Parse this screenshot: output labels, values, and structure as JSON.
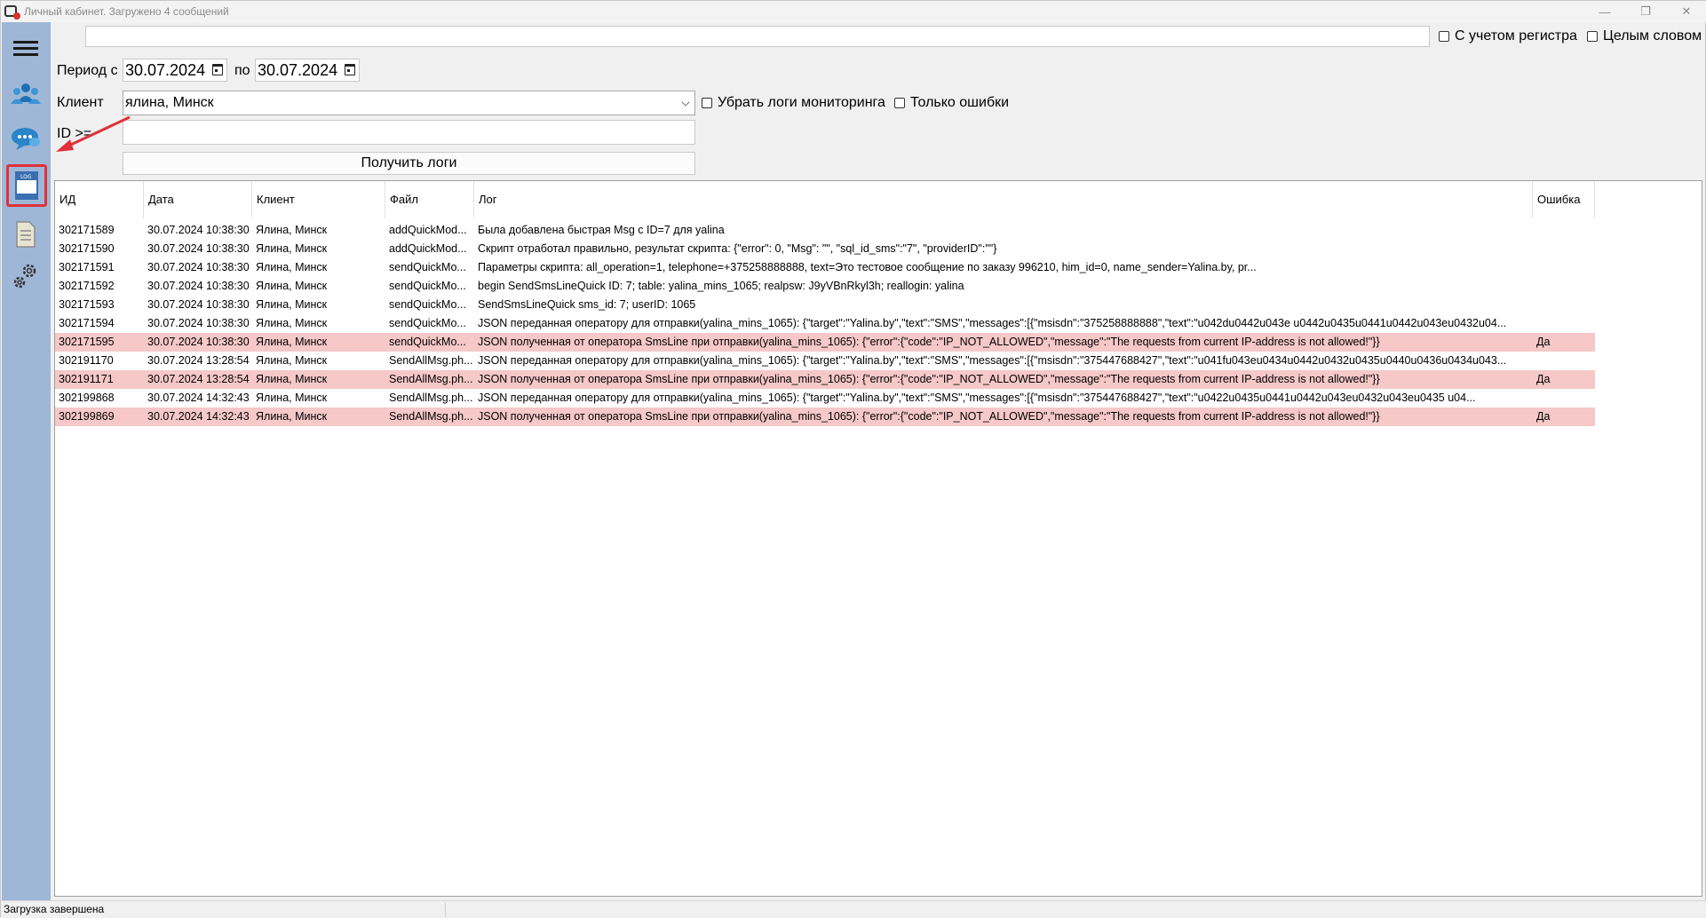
{
  "window": {
    "title": "Личный кабинет. Загружено 4 сообщений",
    "controls": [
      "—",
      "❐",
      "✕"
    ]
  },
  "sidebar": {
    "items": [
      {
        "name": "menu",
        "icon": "hamburger-icon"
      },
      {
        "name": "clients",
        "icon": "users-icon"
      },
      {
        "name": "messages",
        "icon": "chat-icon"
      },
      {
        "name": "logs",
        "icon": "log-file-icon",
        "active": true
      },
      {
        "name": "documents",
        "icon": "document-icon"
      },
      {
        "name": "settings",
        "icon": "gears-icon"
      }
    ]
  },
  "filters": {
    "search_value": "",
    "case_sensitive_label": "С учетом регистра",
    "whole_word_label": "Целым словом",
    "period_label": "Период с",
    "date_from": "30.07.2024",
    "to_label": "по",
    "date_to": "30.07.2024",
    "client_label": "Клиент",
    "client_value": "ялина, Минск",
    "remove_monitoring_label": "Убрать логи мониторинга",
    "only_errors_label": "Только ошибки",
    "id_label": "ID >=",
    "id_value": "",
    "get_logs_label": "Получить логи"
  },
  "grid": {
    "columns": [
      "ИД",
      "Дата",
      "Клиент",
      "Файл",
      "Лог",
      "Ошибка"
    ],
    "rows": [
      {
        "id": "302171589",
        "date": "30.07.2024 10:38:30",
        "client": "Ялина, Минск",
        "file": "addQuickMod...",
        "log": "Была добавлена быстрая Msg с ID=7 для yalina",
        "error": "",
        "is_error": false
      },
      {
        "id": "302171590",
        "date": "30.07.2024 10:38:30",
        "client": "Ялина, Минск",
        "file": "addQuickMod...",
        "log": "Скрипт отработал правильно, результат скрипта: {\"error\": 0, \"Msg\": \"\", \"sql_id_sms\":\"7\", \"providerID\":\"\"}",
        "error": "",
        "is_error": false
      },
      {
        "id": "302171591",
        "date": "30.07.2024 10:38:30",
        "client": "Ялина, Минск",
        "file": "sendQuickMo...",
        "log": "Параметры скрипта:                all_operation=1,                telephone=+375258888888,                text=Это тестовое сообщение по заказу 996210, him_id=0,                name_sender=Yalina.by,                pr...",
        "error": "",
        "is_error": false
      },
      {
        "id": "302171592",
        "date": "30.07.2024 10:38:30",
        "client": "Ялина, Минск",
        "file": "sendQuickMo...",
        "log": "begin SendSmsLineQuick ID: 7; table: yalina_mins_1065; realpsw: J9yVBnRkyl3h; reallogin: yalina",
        "error": "",
        "is_error": false
      },
      {
        "id": "302171593",
        "date": "30.07.2024 10:38:30",
        "client": "Ялина, Минск",
        "file": "sendQuickMo...",
        "log": "SendSmsLineQuick sms_id: 7; userID: 1065",
        "error": "",
        "is_error": false
      },
      {
        "id": "302171594",
        "date": "30.07.2024 10:38:30",
        "client": "Ялина, Минск",
        "file": "sendQuickMo...",
        "log": "JSON переданная оператору для отправки(yalina_mins_1065): {\"target\":\"Yalina.by\",\"text\":\"SMS\",\"messages\":[{\"msisdn\":\"375258888888\",\"text\":\"u042du0442u043e u0442u0435u0441u0442u043eu0432u04...",
        "error": "",
        "is_error": false
      },
      {
        "id": "302171595",
        "date": "30.07.2024 10:38:30",
        "client": "Ялина, Минск",
        "file": "sendQuickMo...",
        "log": "JSON полученная от оператора SmsLine при отправки(yalina_mins_1065): {\"error\":{\"code\":\"IP_NOT_ALLOWED\",\"message\":\"The requests from current IP-address is not allowed!\"}}",
        "error": "Да",
        "is_error": true
      },
      {
        "id": "302191170",
        "date": "30.07.2024 13:28:54",
        "client": "Ялина, Минск",
        "file": "SendAllMsg.ph...",
        "log": "JSON переданная оператору для отправки(yalina_mins_1065): {\"target\":\"Yalina.by\",\"text\":\"SMS\",\"messages\":[{\"msisdn\":\"375447688427\",\"text\":\"u041fu043eu0434u0442u0432u0435u0440u0436u0434u043...",
        "error": "",
        "is_error": false
      },
      {
        "id": "302191171",
        "date": "30.07.2024 13:28:54",
        "client": "Ялина, Минск",
        "file": "SendAllMsg.ph...",
        "log": "JSON полученная от оператора SmsLine при отправки(yalina_mins_1065): {\"error\":{\"code\":\"IP_NOT_ALLOWED\",\"message\":\"The requests from current IP-address is not allowed!\"}}",
        "error": "Да",
        "is_error": true
      },
      {
        "id": "302199868",
        "date": "30.07.2024 14:32:43",
        "client": "Ялина, Минск",
        "file": "SendAllMsg.ph...",
        "log": "JSON переданная оператору для отправки(yalina_mins_1065): {\"target\":\"Yalina.by\",\"text\":\"SMS\",\"messages\":[{\"msisdn\":\"375447688427\",\"text\":\"u0422u0435u0441u0442u043eu0432u043eu0435 u04...",
        "error": "",
        "is_error": false
      },
      {
        "id": "302199869",
        "date": "30.07.2024 14:32:43",
        "client": "Ялина, Минск",
        "file": "SendAllMsg.ph...",
        "log": "JSON полученная от оператора SmsLine при отправки(yalina_mins_1065): {\"error\":{\"code\":\"IP_NOT_ALLOWED\",\"message\":\"The requests from current IP-address is not allowed!\"}}",
        "error": "Да",
        "is_error": true
      }
    ]
  },
  "statusbar": {
    "text": "Загрузка завершена"
  },
  "colors": {
    "sidebar_bg": "#9fb7d7",
    "error_row_bg": "#f6c8c8",
    "annotation_red": "#e0313a"
  }
}
